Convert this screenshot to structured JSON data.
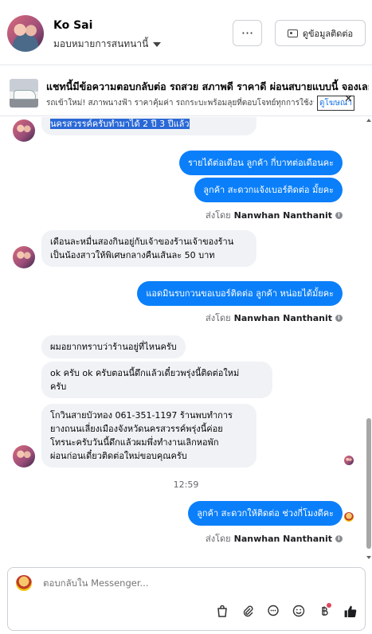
{
  "header": {
    "name": "Ko Sai",
    "assign": "มอบหมายการสนทนานี้",
    "more_label": "···",
    "contact_label": "ดูข้อมูลติดต่อ"
  },
  "ad": {
    "title": "แชทนี้มีข้อความตอบกลับต่อ รถสวย สภาพดี ราคาดี ผ่อนสบายแบบนี้ จองเลย",
    "text": "รถเข้าใหม่! สภาพนางฟ้า ราคาคุ้มค่า รถกระบะพร้อมลุยที่ตอบโจทย์ทุกการใช้งาน",
    "label": "ดูโฆษณา",
    "close": "✕"
  },
  "messages": [
    {
      "id": "m1",
      "dir": "in",
      "lines": [
        "นครสวรรค์ครับทำมาได้ 2 ปี 3 ปีแล้ว"
      ]
    },
    {
      "id": "m2",
      "dir": "out",
      "lines": [
        "รายได้ต่อเดือน ลูกค้า กี่บาทต่อเดือนคะ"
      ]
    },
    {
      "id": "m3",
      "dir": "out",
      "lines": [
        "ลูกค้า สะดวกแจ้งเบอร์ติดต่อ มั้ยคะ"
      ]
    },
    {
      "id": "m4",
      "dir": "in",
      "lines": [
        "เดือนละหมื่นสองกินอยู่กับเจ้าของร้านเจ้าของร้าน",
        "เป็นน้องสาวให้พิเศษกลางคืนเส้นละ 50 บาท"
      ]
    },
    {
      "id": "m5",
      "dir": "out",
      "lines": [
        "แอดมินรบกวนขอเบอร์ติดต่อ ลูกค้า หน่อยได้มั้ยคะ"
      ]
    },
    {
      "id": "m6",
      "dir": "in",
      "lines": [
        "ผมอยากทราบว่าร้านอยู่ที่ไหนครับ"
      ]
    },
    {
      "id": "m7",
      "dir": "in",
      "lines": [
        "ok ครับ ok ครับตอนนี้ดึกแล้วเดี๋ยวพรุ่งนี้ติดต่อใหม่",
        "ครับ"
      ]
    },
    {
      "id": "m8",
      "dir": "in",
      "lines": [
        "โกวินสายบัวทอง 061-351-1197 ร้านพบทำการ",
        "ยางถนนเลี่ยงเมืองจังหวัดนครสวรรค์พรุ่งนี้ค่อย",
        "โทรนะครับวันนี้ดึกแล้วผมพึ่งทำงานเลิกหอพัก",
        "ผ่อนก่อนเดี๋ยวติดต่อใหม่ขอบคุณครับ"
      ]
    },
    {
      "id": "m9",
      "dir": "out",
      "lines": [
        "ลูกค้า สะดวกให้ติดต่อ ช่วงกี่โมงดีคะ"
      ]
    }
  ],
  "sent_by": {
    "prefix": "ส่งโดย",
    "name": "Nanwhan Nanthanit",
    "info": "i"
  },
  "timestamp": "12:59",
  "composer": {
    "placeholder": "ตอบกลับใน Messenger..."
  },
  "toolbar_icons": [
    "bag-icon",
    "paperclip-icon",
    "chat-bubble-icon",
    "emoji-icon",
    "currency-icon",
    "thumbs-up-icon"
  ],
  "colors": {
    "accent": "#0b7ff9",
    "incoming": "#f0f2f5",
    "notification": "#e4465e"
  }
}
